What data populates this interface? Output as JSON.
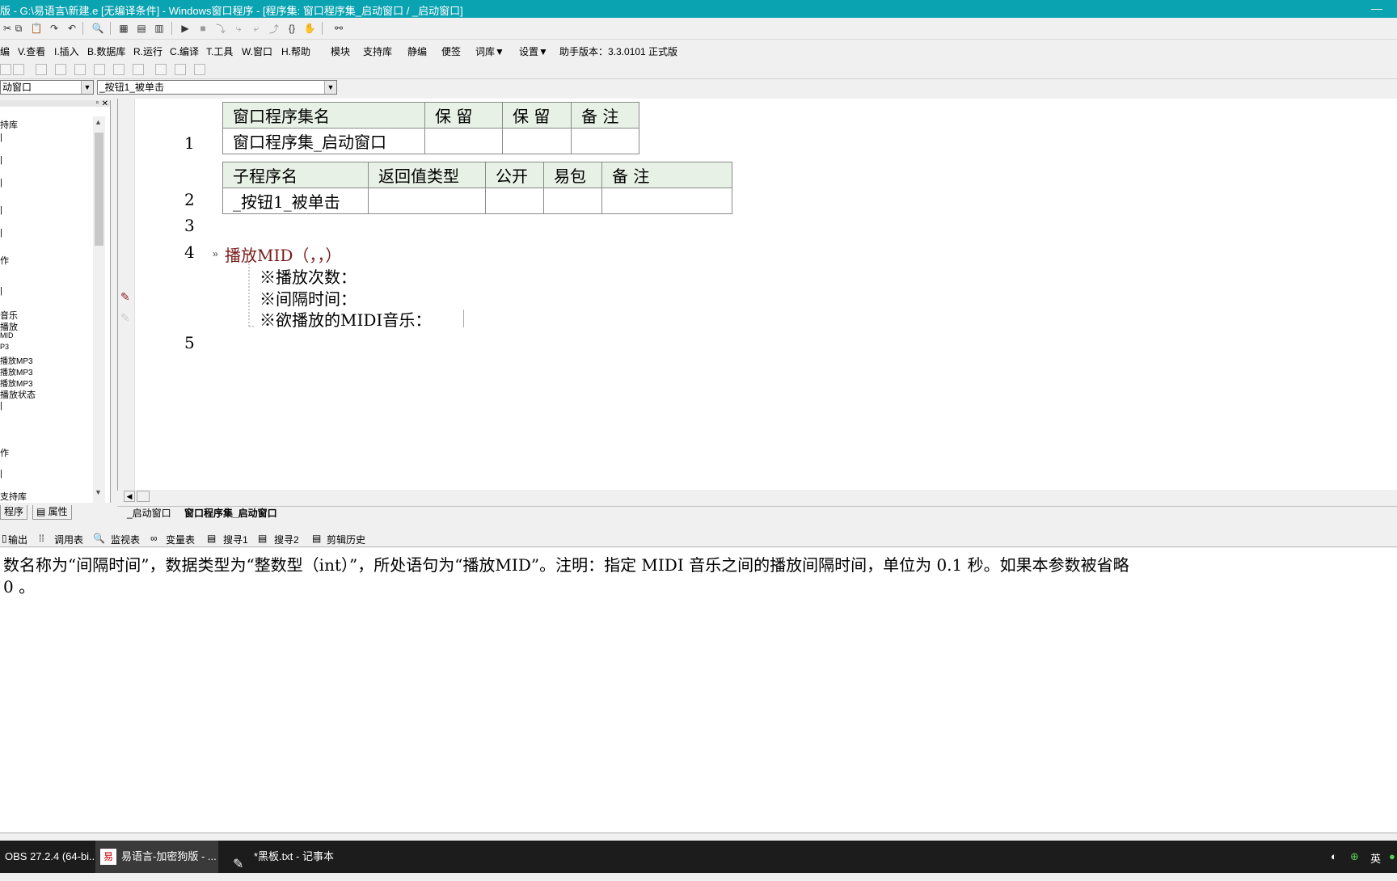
{
  "window": {
    "title": "版 - G:\\易语言\\新建.e [无编译条件] - Windows窗口程序 - [程序集: 窗口程序集_启动窗口 / _启动窗口]",
    "minimize_glyph": "—"
  },
  "menu": {
    "items": [
      "编",
      "V.查看",
      "I.插入",
      "B.数据库",
      "R.运行",
      "C.编译",
      "T.工具",
      "W.窗口",
      "H.帮助",
      "模块",
      "支持库",
      "静编",
      "便签",
      "词库▼",
      "设置▼",
      "助手版本：3.3.0101 正式版"
    ]
  },
  "combos": {
    "window_select": "动窗口",
    "event_select": "_按钮1_被单击"
  },
  "left_panel": {
    "tree_items": [
      "持库",
      "作",
      "音乐",
      "播放",
      "MID",
      "P3",
      "播放MP3",
      "播放MP3",
      "播放MP3",
      "播放状态",
      "作",
      "支持库"
    ],
    "tabs": [
      "程序",
      "属性"
    ]
  },
  "editor": {
    "line_numbers": [
      "1",
      "2",
      "3",
      "4",
      "5"
    ],
    "table1": {
      "headers": [
        "窗口程序集名",
        "保 留",
        "保 留",
        "备 注"
      ],
      "row": [
        "窗口程序集_启动窗口",
        "",
        "",
        ""
      ]
    },
    "table2": {
      "headers": [
        "子程序名",
        "返回值类型",
        "公开",
        "易包",
        "备 注"
      ],
      "row": [
        "_按钮1_被单击",
        "",
        "",
        "",
        ""
      ]
    },
    "statement": "播放MID（，，）",
    "params": [
      "※播放次数：",
      "※间隔时间：",
      "※欲播放的MIDI音乐："
    ]
  },
  "editor_tabs": [
    "_启动窗口",
    "窗口程序集_启动窗口"
  ],
  "bottom_tabs": [
    "输出",
    "调用表",
    "监视表",
    "变量表",
    "搜寻1",
    "搜寻2",
    "剪辑历史"
  ],
  "output": {
    "line1": "数名称为“间隔时间”，数据类型为“整数型（int）”，所处语句为“播放MID”。注明：指定 MIDI 音乐之间的播放间隔时间，单位为 0.1 秒。如果本参数被省略",
    "line2": " 0 。"
  },
  "taskbar": {
    "items": [
      "OBS 27.2.4 (64-bi...",
      "易语言-加密狗版 - ...",
      "*黑板.txt - 记事本"
    ],
    "ime": "英"
  },
  "colors": {
    "titlebar": "#0aa3b1",
    "table_header": "#e8f1e6",
    "statement_text": "#7a1a1a",
    "taskbar": "#1c1c1c"
  }
}
